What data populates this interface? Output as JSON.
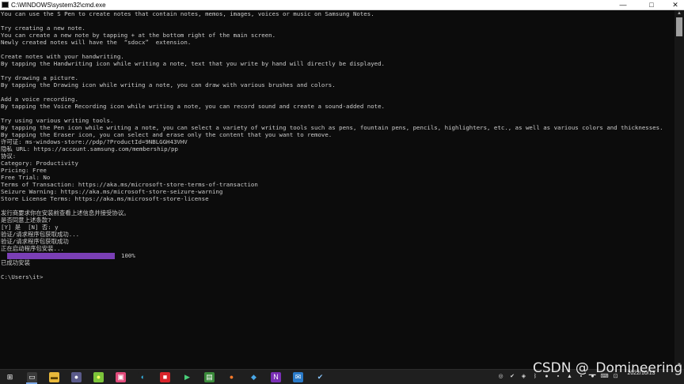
{
  "window": {
    "title": "C:\\WINDOWS\\system32\\cmd.exe",
    "minimize_glyph": "—",
    "maximize_glyph": "□",
    "close_glyph": "✕"
  },
  "console_lines_top": [
    "You can use the S Pen to create notes that contain notes, memos, images, voices or music on Samsung Notes.",
    "",
    "Try creating a new note.",
    "You can create a new note by tapping + at the bottom right of the main screen.",
    "Newly created notes will have the  “sdocx”  extension.",
    "",
    "Create notes with your handwriting.",
    "By tapping the Handwriting icon while writing a note, text that you write by hand will directly be displayed.",
    "",
    "Try drawing a picture.",
    "By tapping the Drawing icon while writing a note, you can draw with various brushes and colors.",
    "",
    "Add a voice recording.",
    "By tapping the Voice Recording icon while writing a note, you can record sound and create a sound-added note.",
    "",
    "Try using various writing tools.",
    "By tapping the Pen icon while writing a note, you can select a variety of writing tools such as pens, fountain pens, pencils, highlighters, etc., as well as various colors and thicknesses.",
    "By tapping the Eraser icon, you can select and erase only the content that you want to remove.",
    "许可证: ms-windows-store://pdp/?ProductId=9NBLGGH43VHV",
    "隐私 URL: https://account.samsung.com/membership/pp",
    "协议:",
    "Category: Productivity",
    "Pricing: Free",
    "Free Trial: No",
    "Terms of Transaction: https://aka.ms/microsoft-store-terms-of-transaction",
    "Seizure Warning: https://aka.ms/microsoft-store-seizure-warning",
    "Store License Terms: https://aka.ms/microsoft-store-license",
    "",
    "发行商要求你在安装前查看上述信息并接受协议。",
    "是否同意上述条款?",
    "[Y] 是  [N] 否: y",
    "验证/请求程序包获取成功...",
    "验证/请求程序包获取成功",
    "正在启动程序包安装..."
  ],
  "progress": {
    "fraction": 1.0,
    "label": "100%",
    "color": "#7a3fb5"
  },
  "console_lines_bottom": [
    "已成功安装",
    "",
    "C:\\Users\\it>"
  ],
  "scrollbar": {
    "up_glyph": "▲",
    "down_glyph": "▼"
  },
  "taskbar": {
    "icons": [
      {
        "name": "start-icon",
        "glyph": "⊞",
        "bg": "#1f1f1f",
        "color": "#ffffff"
      },
      {
        "name": "cmd-icon",
        "glyph": "▭",
        "bg": "#3a3a3a",
        "color": "#ffffff"
      },
      {
        "name": "file-explorer-icon",
        "glyph": "▬",
        "bg": "#e8b83a",
        "color": "#5a4000"
      },
      {
        "name": "media-app-icon",
        "glyph": "●",
        "bg": "#5a5a8a",
        "color": "#ffffff"
      },
      {
        "name": "green-app-icon",
        "glyph": "●",
        "bg": "#7cc43a",
        "color": "#ffff60"
      },
      {
        "name": "pink-app-icon",
        "glyph": "▣",
        "bg": "#e04a7a",
        "color": "#ffffff"
      },
      {
        "name": "edge-browser-icon",
        "glyph": "◐",
        "bg": "#1f1f1f",
        "color": "#36b5e8"
      },
      {
        "name": "red-app-icon",
        "glyph": "■",
        "bg": "#d8242a",
        "color": "#ffffff"
      },
      {
        "name": "play-app-icon",
        "glyph": "▶",
        "bg": "#1f1f1f",
        "color": "#4ad07a"
      },
      {
        "name": "green-doc-icon",
        "glyph": "▤",
        "bg": "#3a8a3a",
        "color": "#ffffff"
      },
      {
        "name": "firefox-icon",
        "glyph": "●",
        "bg": "#1f1f1f",
        "color": "#ff7b2a"
      },
      {
        "name": "blue-app-icon",
        "glyph": "◆",
        "bg": "#1f1f1f",
        "color": "#4aa8e8"
      },
      {
        "name": "onenote-icon",
        "glyph": "N",
        "bg": "#7a2fb5",
        "color": "#ffffff"
      },
      {
        "name": "mail-icon",
        "glyph": "✉",
        "bg": "#2a7ac8",
        "color": "#ffffff"
      },
      {
        "name": "store-app-icon",
        "glyph": "✔",
        "bg": "#1f1f1f",
        "color": "#8ac8ff"
      }
    ],
    "tray_icons": [
      {
        "name": "tray-app-icon-1",
        "glyph": "◎"
      },
      {
        "name": "tray-steam-icon",
        "glyph": "✔"
      },
      {
        "name": "tray-app-icon-2",
        "glyph": "◈"
      },
      {
        "name": "tray-bluetooth-icon",
        "glyph": "ᛒ"
      },
      {
        "name": "tray-app-icon-3",
        "glyph": "●"
      },
      {
        "name": "tray-app-icon-4",
        "glyph": "▪"
      },
      {
        "name": "tray-app-icon-5",
        "glyph": "▲"
      },
      {
        "name": "tray-app-icon-6",
        "glyph": "▪"
      },
      {
        "name": "tray-app-icon-7",
        "glyph": "●"
      },
      {
        "name": "tray-keyboard-icon",
        "glyph": "⌨"
      },
      {
        "name": "tray-network-icon",
        "glyph": "⊡"
      }
    ],
    "clock_date": "2022/10/13"
  },
  "watermark": "CSDN @_Domineering"
}
